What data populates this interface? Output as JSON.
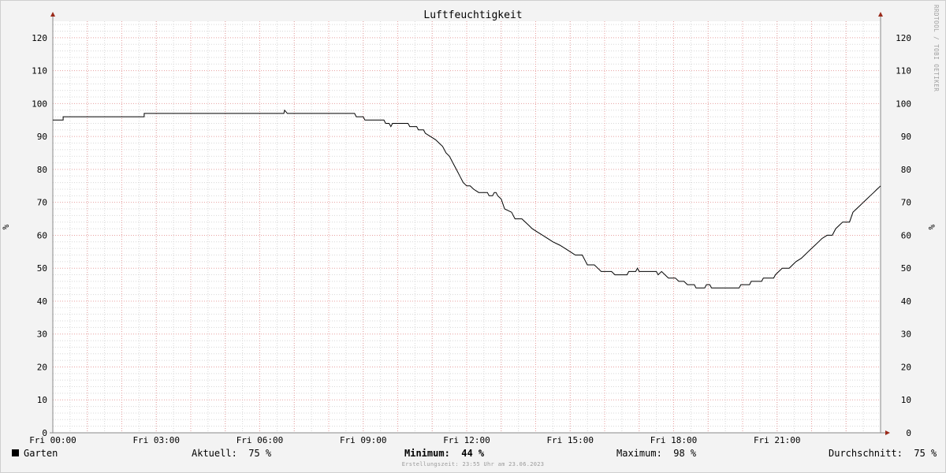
{
  "chart_data": {
    "type": "line",
    "title": "Luftfeuchtigkeit",
    "ylabel": "%",
    "xlabel": "",
    "ylim": [
      0,
      125
    ],
    "xlim": [
      0,
      24
    ],
    "y_ticks": [
      0,
      10,
      20,
      30,
      40,
      50,
      60,
      70,
      80,
      90,
      100,
      110,
      120
    ],
    "x_ticks": [
      {
        "hour": 0,
        "label": "Fri 00:00"
      },
      {
        "hour": 3,
        "label": "Fri 03:00"
      },
      {
        "hour": 6,
        "label": "Fri 06:00"
      },
      {
        "hour": 9,
        "label": "Fri 09:00"
      },
      {
        "hour": 12,
        "label": "Fri 12:00"
      },
      {
        "hour": 15,
        "label": "Fri 15:00"
      },
      {
        "hour": 18,
        "label": "Fri 18:00"
      },
      {
        "hour": 21,
        "label": "Fri 21:00"
      }
    ],
    "grid": true,
    "series": [
      {
        "name": "Garten",
        "color": "#000000",
        "points": [
          [
            0.0,
            95
          ],
          [
            0.3,
            95
          ],
          [
            0.3,
            96
          ],
          [
            2.65,
            96
          ],
          [
            2.65,
            97
          ],
          [
            6.7,
            97
          ],
          [
            6.72,
            98
          ],
          [
            6.8,
            97
          ],
          [
            8.75,
            97
          ],
          [
            8.8,
            96
          ],
          [
            9.0,
            96
          ],
          [
            9.05,
            95
          ],
          [
            9.6,
            95
          ],
          [
            9.65,
            94
          ],
          [
            9.75,
            94
          ],
          [
            9.8,
            93
          ],
          [
            9.85,
            94
          ],
          [
            10.3,
            94
          ],
          [
            10.35,
            93
          ],
          [
            10.55,
            93
          ],
          [
            10.6,
            92
          ],
          [
            10.75,
            92
          ],
          [
            10.8,
            91
          ],
          [
            10.95,
            90
          ],
          [
            11.1,
            89
          ],
          [
            11.2,
            88
          ],
          [
            11.3,
            87
          ],
          [
            11.4,
            85
          ],
          [
            11.5,
            84
          ],
          [
            11.6,
            82
          ],
          [
            11.7,
            80
          ],
          [
            11.8,
            78
          ],
          [
            11.9,
            76
          ],
          [
            12.0,
            75
          ],
          [
            12.1,
            75
          ],
          [
            12.2,
            74
          ],
          [
            12.35,
            73
          ],
          [
            12.6,
            73
          ],
          [
            12.65,
            72
          ],
          [
            12.75,
            72
          ],
          [
            12.8,
            73
          ],
          [
            12.85,
            73
          ],
          [
            12.9,
            72
          ],
          [
            13.0,
            71
          ],
          [
            13.1,
            68
          ],
          [
            13.3,
            67
          ],
          [
            13.4,
            65
          ],
          [
            13.6,
            65
          ],
          [
            13.7,
            64
          ],
          [
            13.8,
            63
          ],
          [
            13.9,
            62
          ],
          [
            14.05,
            61
          ],
          [
            14.2,
            60
          ],
          [
            14.35,
            59
          ],
          [
            14.5,
            58
          ],
          [
            14.7,
            57
          ],
          [
            14.85,
            56
          ],
          [
            15.0,
            55
          ],
          [
            15.15,
            54
          ],
          [
            15.35,
            54
          ],
          [
            15.45,
            52
          ],
          [
            15.5,
            51
          ],
          [
            15.7,
            51
          ],
          [
            15.8,
            50
          ],
          [
            15.9,
            49
          ],
          [
            16.2,
            49
          ],
          [
            16.3,
            48
          ],
          [
            16.65,
            48
          ],
          [
            16.7,
            49
          ],
          [
            16.9,
            49
          ],
          [
            16.95,
            50
          ],
          [
            17.0,
            49
          ],
          [
            17.5,
            49
          ],
          [
            17.55,
            48
          ],
          [
            17.65,
            49
          ],
          [
            17.75,
            48
          ],
          [
            17.85,
            47
          ],
          [
            18.05,
            47
          ],
          [
            18.15,
            46
          ],
          [
            18.3,
            46
          ],
          [
            18.4,
            45
          ],
          [
            18.6,
            45
          ],
          [
            18.65,
            44
          ],
          [
            18.9,
            44
          ],
          [
            18.95,
            45
          ],
          [
            19.05,
            45
          ],
          [
            19.1,
            44
          ],
          [
            19.9,
            44
          ],
          [
            19.95,
            45
          ],
          [
            20.2,
            45
          ],
          [
            20.25,
            46
          ],
          [
            20.55,
            46
          ],
          [
            20.6,
            47
          ],
          [
            20.9,
            47
          ],
          [
            20.95,
            48
          ],
          [
            21.05,
            49
          ],
          [
            21.15,
            50
          ],
          [
            21.35,
            50
          ],
          [
            21.45,
            51
          ],
          [
            21.55,
            52
          ],
          [
            21.7,
            53
          ],
          [
            21.8,
            54
          ],
          [
            21.9,
            55
          ],
          [
            22.0,
            56
          ],
          [
            22.1,
            57
          ],
          [
            22.2,
            58
          ],
          [
            22.3,
            59
          ],
          [
            22.45,
            60
          ],
          [
            22.6,
            60
          ],
          [
            22.7,
            62
          ],
          [
            22.8,
            63
          ],
          [
            22.9,
            64
          ],
          [
            23.1,
            64
          ],
          [
            23.2,
            67
          ],
          [
            23.3,
            68
          ],
          [
            23.4,
            69
          ],
          [
            23.5,
            70
          ],
          [
            23.6,
            71
          ],
          [
            23.7,
            72
          ],
          [
            23.8,
            73
          ],
          [
            23.9,
            74
          ],
          [
            24.0,
            75
          ]
        ]
      }
    ]
  },
  "legend": {
    "series_name": "Garten",
    "aktuell_label": "Aktuell:",
    "aktuell_value": "75 %",
    "minimum_label": "Minimum:",
    "minimum_value": "44 %",
    "maximum_label": "Maximum:",
    "maximum_value": "98 %",
    "durchschnitt_label": "Durchschnitt:",
    "durchschnitt_value": "75 %"
  },
  "footer": "Erstellungszeit: 23:55 Uhr am 23.06.2023",
  "watermark": "RRDTOOL / TOBI OETIKER",
  "colors": {
    "line": "#000000",
    "major_grid": "#e8a0a0",
    "minor_grid": "#d8d8d8",
    "axis": "#888888",
    "arrow": "#9a2a1a",
    "plot_bg": "#ffffff"
  }
}
